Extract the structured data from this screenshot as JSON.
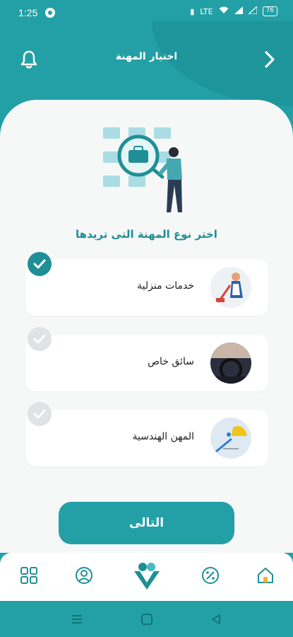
{
  "status_bar": {
    "time": "1:25",
    "signal_text": "LTE",
    "battery": "76",
    "icons": [
      "vibrate-icon",
      "data-icon",
      "wifi-icon",
      "signal-icon",
      "signal-icon",
      "battery-icon"
    ]
  },
  "header": {
    "title": "اختيار المهنة",
    "left_icon": "bell-icon",
    "right_icon": "chevron-right-icon"
  },
  "subtitle": "اختر نوع المهنة التى تريدها",
  "options": [
    {
      "label": "خدمات منزلية",
      "selected": true,
      "avatar": "housekeeper-image"
    },
    {
      "label": "سائق خاص",
      "selected": false,
      "avatar": "car-interior-image"
    },
    {
      "label": "المهن الهندسية",
      "selected": false,
      "avatar": "engineering-tools-image"
    }
  ],
  "next_button": "التالى",
  "bottom_nav": [
    "grid-icon",
    "profile-icon",
    "logo-icon",
    "discount-icon",
    "home-icon"
  ],
  "colors": {
    "primary": "#23a0a6",
    "primary_dark": "#1f8f97",
    "card": "#f6f7f7",
    "check_off": "#dfe3e4"
  }
}
